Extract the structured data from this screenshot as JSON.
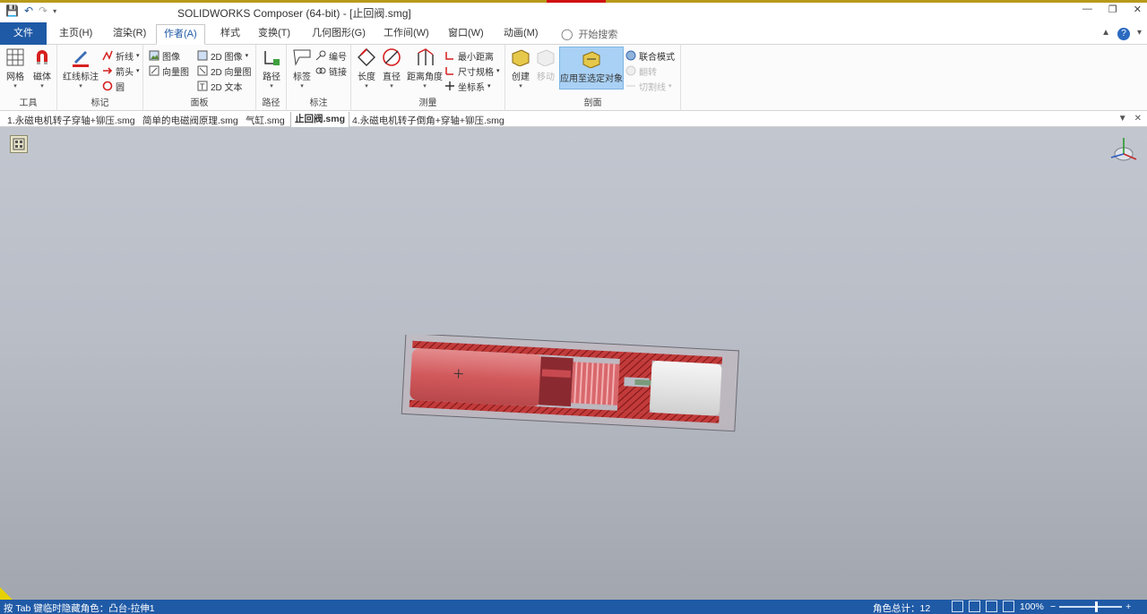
{
  "titlebar": {
    "title": "SOLIDWORKS Composer (64-bit) - [止回阀.smg]",
    "window_controls": [
      "—",
      "❐",
      "✕"
    ]
  },
  "tabs": {
    "file": "文件",
    "items": [
      "主页(H)",
      "渲染(R)",
      "作者(A)",
      "样式",
      "变换(T)",
      "几何图形(G)",
      "工作间(W)",
      "窗口(W)",
      "动画(M)"
    ],
    "active": "作者(A)",
    "search_placeholder": "开始搜索"
  },
  "ribbon": {
    "tools": {
      "label": "工具",
      "grid": "网格",
      "magnet": "磁体"
    },
    "markup": {
      "label": "标记",
      "redline": "红线标注",
      "polyline": "折线",
      "arrow": "箭头",
      "circle": "圆"
    },
    "panel": {
      "label": "面板",
      "image": "图像",
      "vector_image": "向量图",
      "image2d": "2D 图像",
      "vector2d": "2D 向量图",
      "text2d": "2D 文本"
    },
    "path": {
      "label": "路径",
      "path": "路径"
    },
    "annotate": {
      "label": "标注",
      "tag": "标签",
      "number": "编号",
      "link": "链接"
    },
    "measure": {
      "label": "测量",
      "length": "长度",
      "diameter": "直径",
      "distance_angle": "距离角度",
      "min_distance": "最小距离",
      "dimension": "尺寸规格",
      "coordinate": "坐标系"
    },
    "section": {
      "label": "剖面",
      "create": "创建",
      "move": "移动",
      "apply": "应用至选定对象",
      "union_mode": "联合模式",
      "flip": "翻转",
      "cut_line": "切割线"
    }
  },
  "doctabs": {
    "items": [
      "1.永磁电机转子穿轴+铆压.smg",
      "简单的电磁阀原理.smg",
      "气缸.smg",
      "止回阀.smg",
      "4.永磁电机转子倒角+穿轴+铆压.smg"
    ],
    "active": "止回阀.smg"
  },
  "statusbar": {
    "message": "按 Tab 键临时隐藏角色：凸台-拉伸1",
    "actor_count": "角色总计：12",
    "zoom": "100%"
  },
  "colors": {
    "accent": "#1f5aa6",
    "part_red": "#c8484e",
    "section_hatch": "#b02a2a"
  }
}
